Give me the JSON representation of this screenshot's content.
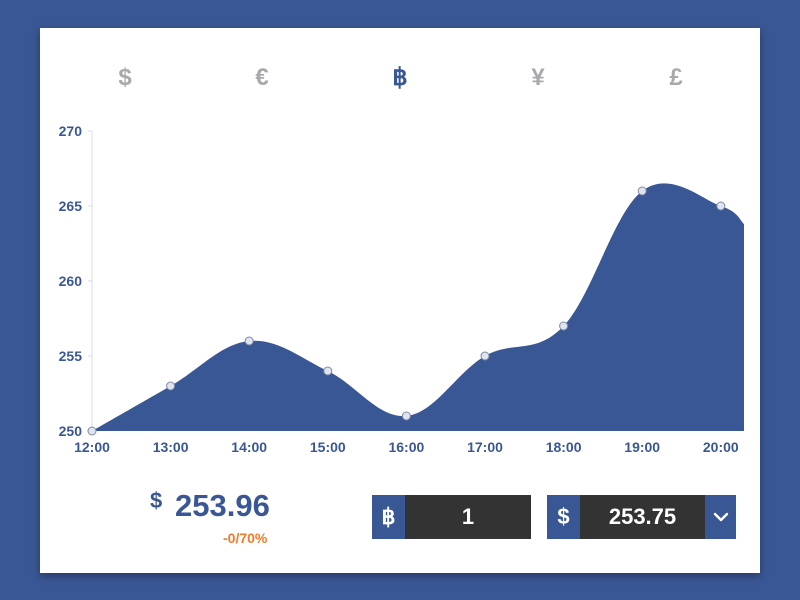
{
  "currency_tabs": [
    {
      "symbol": "$",
      "icon": "dollar-icon",
      "active": false
    },
    {
      "symbol": "€",
      "icon": "euro-icon",
      "active": false
    },
    {
      "symbol": "฿",
      "icon": "bitcoin-icon",
      "active": true
    },
    {
      "symbol": "¥",
      "icon": "yen-icon",
      "active": false
    },
    {
      "symbol": "£",
      "icon": "pound-icon",
      "active": false
    }
  ],
  "chart_data": {
    "type": "area",
    "x": [
      "12:00",
      "13:00",
      "14:00",
      "15:00",
      "16:00",
      "17:00",
      "18:00",
      "19:00",
      "20:00"
    ],
    "values": [
      250,
      253,
      256,
      254,
      251,
      255,
      257,
      266,
      265
    ],
    "last_value": 263.8,
    "ylim": [
      250,
      270
    ],
    "yticks": [
      250,
      255,
      260,
      265,
      270
    ],
    "grid": false,
    "colors": {
      "fill": "#3a5795",
      "point": "#dfe4ee",
      "axis_text": "#3a5795",
      "axis_line": "#d9dce3"
    }
  },
  "price": {
    "symbol": "$",
    "value": "253.96",
    "change": "-0/70%",
    "change_color": "#f07a2b"
  },
  "converter": {
    "from": {
      "symbol": "฿",
      "icon": "bitcoin-icon",
      "value": "1"
    },
    "to": {
      "symbol": "$",
      "icon": "dollar-icon",
      "value": "253.75"
    },
    "dropdown_icon": "chevron-down-icon"
  }
}
